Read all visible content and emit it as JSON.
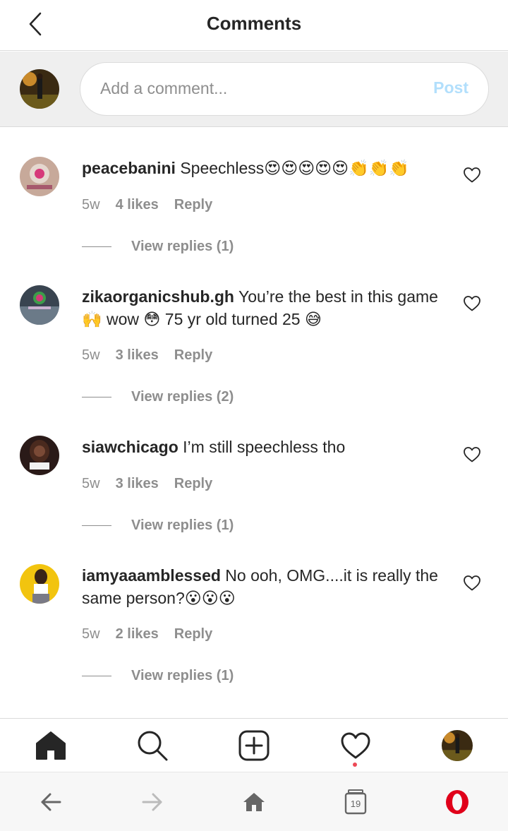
{
  "header": {
    "title": "Comments"
  },
  "composer": {
    "placeholder": "Add a comment...",
    "post_label": "Post"
  },
  "comments": [
    {
      "username": "peacebanini",
      "text": " Speechless😍😍😍😍😍👏👏👏",
      "time": "5w",
      "likes": "4 likes",
      "reply": "Reply",
      "view_replies": "View replies (1)"
    },
    {
      "username": "zikaorganicshub.gh",
      "text": " You’re the best in this game 🙌 wow 😳 75 yr old turned 25 😅",
      "time": "5w",
      "likes": "3 likes",
      "reply": "Reply",
      "view_replies": "View replies (2)"
    },
    {
      "username": "siawchicago",
      "text": " I’m still speechless tho",
      "time": "5w",
      "likes": "3 likes",
      "reply": "Reply",
      "view_replies": "View replies (1)"
    },
    {
      "username": "iamyaaamblessed",
      "text": " No ooh, OMG....it is really the same person?😮😮😮",
      "time": "5w",
      "likes": "2 likes",
      "reply": "Reply",
      "view_replies": "View replies (1)"
    }
  ],
  "browser": {
    "tabs_count": "19"
  },
  "icons": {
    "back": "chevron-left-icon",
    "home": "home-icon",
    "search": "search-icon",
    "new_post": "plus-square-icon",
    "activity": "heart-icon",
    "profile": "avatar",
    "like": "heart-outline-icon",
    "browser_menu": "opera-logo"
  },
  "colors": {
    "post_disabled": "#b2dffc",
    "secondary_text": "#8e8e8e",
    "notification_dot": "#ed4956",
    "opera_red": "#e0001a"
  }
}
